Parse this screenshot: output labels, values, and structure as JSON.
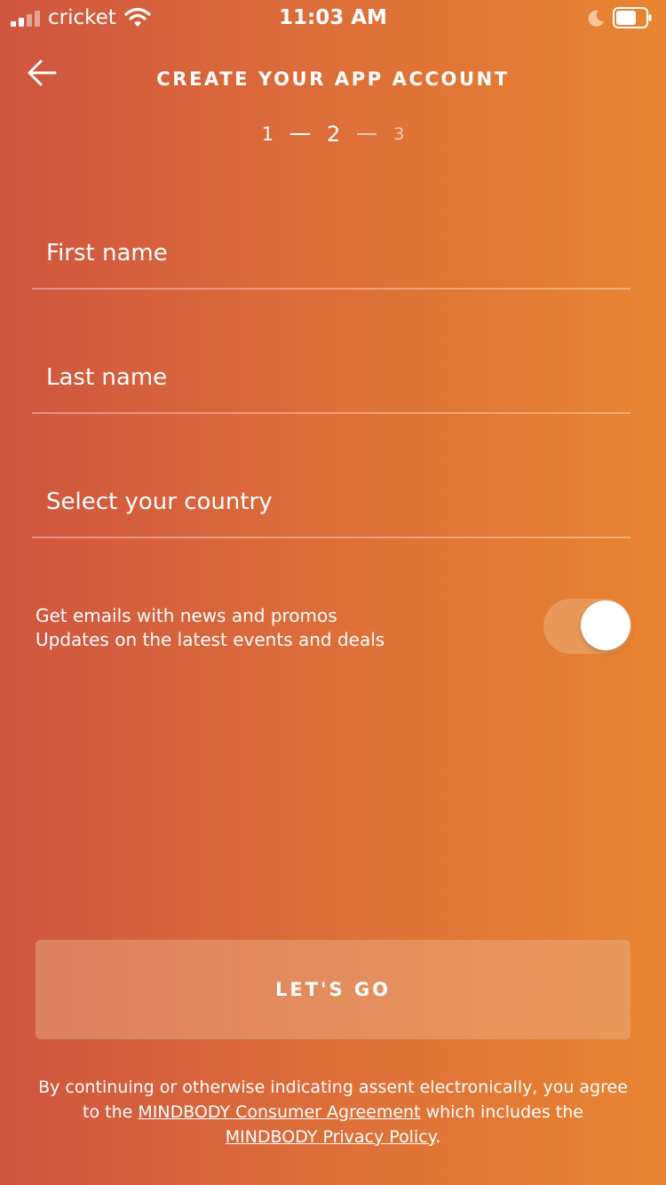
{
  "status_bar": {
    "carrier": "cricket",
    "time": "11:03 AM"
  },
  "header": {
    "title": "CREATE YOUR APP ACCOUNT",
    "steps": [
      "1",
      "2",
      "3"
    ],
    "current_step": 2
  },
  "form": {
    "first_name_placeholder": "First name",
    "last_name_placeholder": "Last name",
    "country_placeholder": "Select your country"
  },
  "promo": {
    "line1": "Get emails with news and promos",
    "line2": "Updates on the latest events and deals",
    "toggle_on": true
  },
  "button": {
    "label": "LET'S GO"
  },
  "legal": {
    "part1": "By continuing or otherwise indicating assent electronically, you agree to the ",
    "link1": "MINDBODY Consumer Agreement",
    "part2": " which includes the ",
    "link2": "MINDBODY Privacy Policy",
    "part3": "."
  },
  "icons": {
    "back": "arrow-left-icon",
    "signal": "cellular-signal-icon",
    "wifi": "wifi-icon",
    "moon": "moon-icon",
    "battery": "battery-icon"
  },
  "colors": {
    "gradient_start": "#cf5540",
    "gradient_end": "#e88532"
  }
}
